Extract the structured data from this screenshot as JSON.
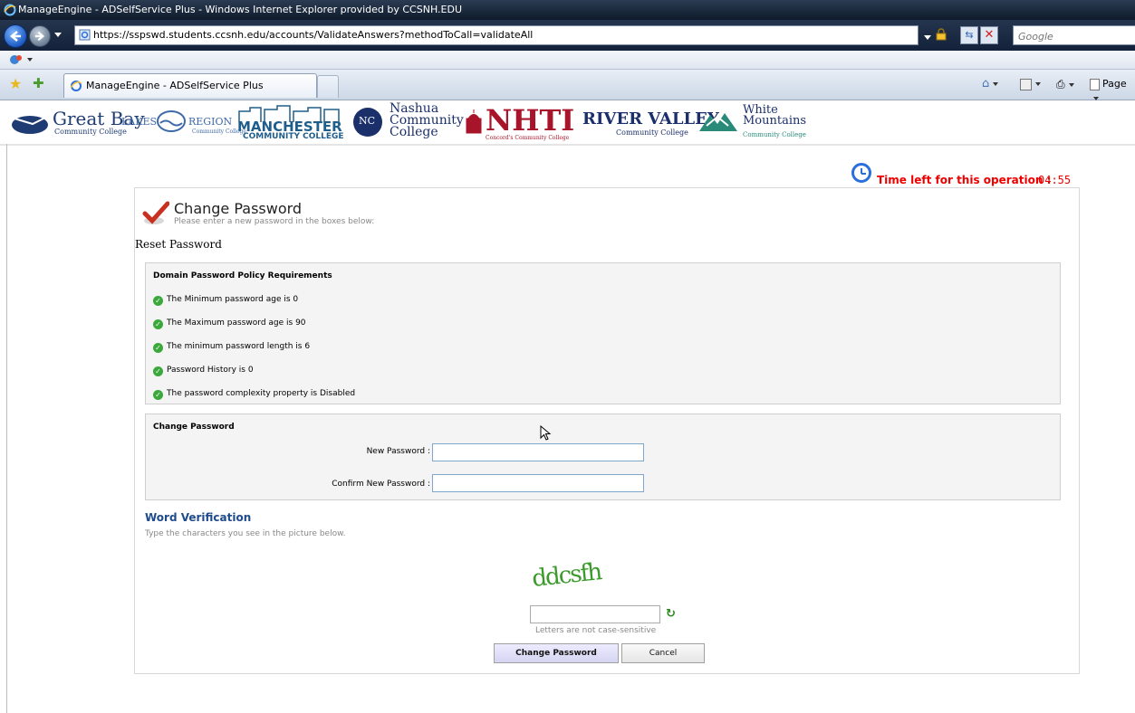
{
  "window": {
    "title": "ManageEngine - ADSelfService Plus - Windows Internet Explorer provided by CCSNH.EDU"
  },
  "browser": {
    "url": "https://sspswd.students.ccsnh.edu/accounts/ValidateAnswers?methodToCall=validateAll",
    "search_placeholder": "Google",
    "tab_title": "ManageEngine - ADSelfService Plus",
    "page_menu": "Page"
  },
  "logos": {
    "great_bay": "Great Bay",
    "great_bay_sub": "Community College",
    "lakes": "LAKES",
    "region": "REGION",
    "region_sub": "Community College",
    "manchester": "MANCHESTER",
    "manchester_sub": "COMMUNITY COLLEGE",
    "nashua_initials": "NC",
    "nashua_1": "Nashua",
    "nashua_2": "Community",
    "nashua_3": "College",
    "nhti": "NHTI",
    "nhti_sub": "Concord's Community College",
    "river_valley": "RIVER VALLEY",
    "river_valley_sub": "Community College",
    "white_1": "White",
    "white_2": "Mountains",
    "white_sub": "Community College"
  },
  "timer": {
    "label": "Time left for this operation :",
    "value": "04:55"
  },
  "header": {
    "title": "Change Password",
    "subtitle": "Please enter a new password in the boxes below:",
    "section": "Reset Password"
  },
  "policy": {
    "title": "Domain Password Policy Requirements",
    "items": [
      "The Minimum password age is 0",
      "The Maximum password age is 90",
      "The minimum password length is 6",
      "Password History is 0",
      "The password complexity property is Disabled"
    ]
  },
  "change": {
    "title": "Change Password",
    "new_label": "New Password :",
    "confirm_label": "Confirm New Password :",
    "new_value": "",
    "confirm_value": ""
  },
  "verification": {
    "title": "Word Verification",
    "subtitle": "Type the characters you see in the picture below.",
    "captcha_text": "ddcsfh",
    "note": "Letters are not case-sensitive",
    "value": ""
  },
  "buttons": {
    "submit": "Change Password",
    "cancel": "Cancel"
  },
  "colors": {
    "timer_red": "#e00000",
    "heading_blue": "#1f4b8c",
    "check_green": "#3aa83a"
  }
}
